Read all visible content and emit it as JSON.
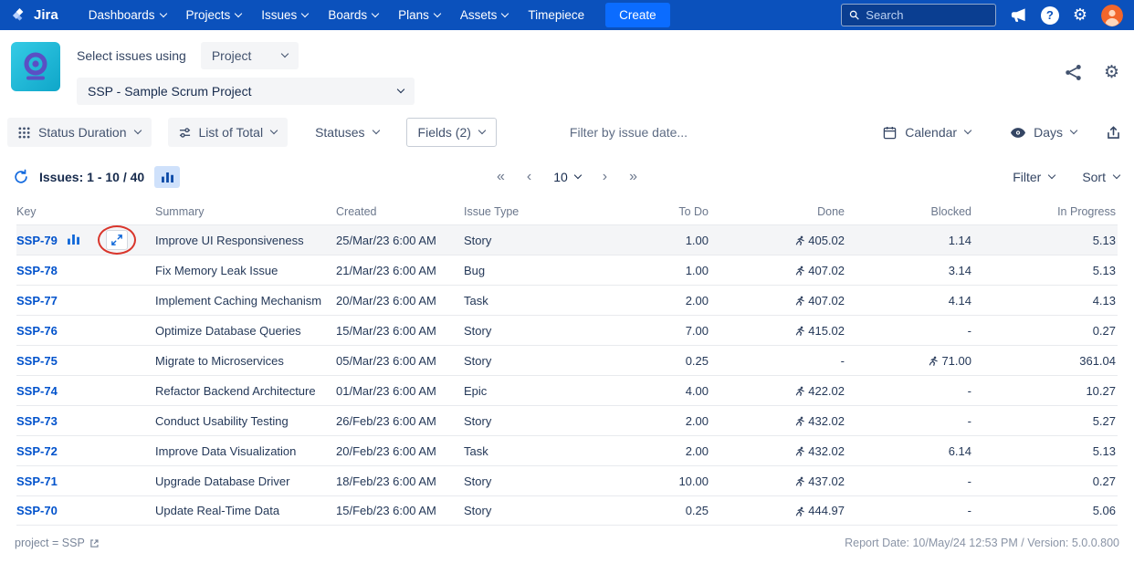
{
  "colors": {
    "nav_bg": "#0B51BC",
    "create_button": "#0B6CFF",
    "link": "#0052CC",
    "app_icon_bg": "#1BBBD4",
    "app_icon_fg": "#5B4FC4",
    "annotation_red": "#D9352B",
    "row_hover": "#F4F5F7"
  },
  "icons": {
    "help": "?",
    "gear": "⚙",
    "first_page": "«",
    "prev_page": "‹",
    "next_page": "›",
    "last_page": "»"
  },
  "topnav": {
    "brand": "Jira",
    "menus": [
      "Dashboards",
      "Projects",
      "Issues",
      "Boards",
      "Plans",
      "Assets",
      "Timepiece"
    ],
    "create_label": "Create",
    "search_placeholder": "Search"
  },
  "header": {
    "select_label": "Select issues using",
    "source_value": "Project",
    "project_value": "SSP - Sample Scrum Project"
  },
  "toolbar": {
    "status_duration_label": "Status Duration",
    "list_of_total_label": "List of Total",
    "statuses_label": "Statuses",
    "fields_label": "Fields (2)",
    "date_filter_placeholder": "Filter by issue date...",
    "calendar_label": "Calendar",
    "days_label": "Days"
  },
  "issues_bar": {
    "issues_label": "Issues: 1 - 10 / 40",
    "page_size": "10",
    "filter_label": "Filter",
    "sort_label": "Sort"
  },
  "table": {
    "columns": [
      "Key",
      "Summary",
      "Created",
      "Issue Type",
      "To Do",
      "Done",
      "Blocked",
      "In Progress"
    ],
    "rows": [
      {
        "key": "SSP-79",
        "summary": "Improve UI Responsiveness",
        "created": "25/Mar/23 6:00 AM",
        "issue_type": "Story",
        "todo": "1.00",
        "done": "405.02",
        "blocked": "1.14",
        "in_progress": "5.13",
        "done_icon": true,
        "blocked_icon": false,
        "actions": true,
        "highlighted": true
      },
      {
        "key": "SSP-78",
        "summary": "Fix Memory Leak Issue",
        "created": "21/Mar/23 6:00 AM",
        "issue_type": "Bug",
        "todo": "1.00",
        "done": "407.02",
        "blocked": "3.14",
        "in_progress": "5.13",
        "done_icon": true,
        "blocked_icon": false,
        "actions": false,
        "highlighted": false
      },
      {
        "key": "SSP-77",
        "summary": "Implement Caching Mechanism",
        "created": "20/Mar/23 6:00 AM",
        "issue_type": "Task",
        "todo": "2.00",
        "done": "407.02",
        "blocked": "4.14",
        "in_progress": "4.13",
        "done_icon": true,
        "blocked_icon": false,
        "actions": false,
        "highlighted": false
      },
      {
        "key": "SSP-76",
        "summary": "Optimize Database Queries",
        "created": "15/Mar/23 6:00 AM",
        "issue_type": "Story",
        "todo": "7.00",
        "done": "415.02",
        "blocked": "-",
        "in_progress": "0.27",
        "done_icon": true,
        "blocked_icon": false,
        "actions": false,
        "highlighted": false
      },
      {
        "key": "SSP-75",
        "summary": "Migrate to Microservices",
        "created": "05/Mar/23 6:00 AM",
        "issue_type": "Story",
        "todo": "0.25",
        "done": "-",
        "blocked": "71.00",
        "in_progress": "361.04",
        "done_icon": false,
        "blocked_icon": true,
        "actions": false,
        "highlighted": false
      },
      {
        "key": "SSP-74",
        "summary": "Refactor Backend Architecture",
        "created": "01/Mar/23 6:00 AM",
        "issue_type": "Epic",
        "todo": "4.00",
        "done": "422.02",
        "blocked": "-",
        "in_progress": "10.27",
        "done_icon": true,
        "blocked_icon": false,
        "actions": false,
        "highlighted": false
      },
      {
        "key": "SSP-73",
        "summary": "Conduct Usability Testing",
        "created": "26/Feb/23 6:00 AM",
        "issue_type": "Story",
        "todo": "2.00",
        "done": "432.02",
        "blocked": "-",
        "in_progress": "5.27",
        "done_icon": true,
        "blocked_icon": false,
        "actions": false,
        "highlighted": false
      },
      {
        "key": "SSP-72",
        "summary": "Improve Data Visualization",
        "created": "20/Feb/23 6:00 AM",
        "issue_type": "Task",
        "todo": "2.00",
        "done": "432.02",
        "blocked": "6.14",
        "in_progress": "5.13",
        "done_icon": true,
        "blocked_icon": false,
        "actions": false,
        "highlighted": false
      },
      {
        "key": "SSP-71",
        "summary": "Upgrade Database Driver",
        "created": "18/Feb/23 6:00 AM",
        "issue_type": "Story",
        "todo": "10.00",
        "done": "437.02",
        "blocked": "-",
        "in_progress": "0.27",
        "done_icon": true,
        "blocked_icon": false,
        "actions": false,
        "highlighted": false
      },
      {
        "key": "SSP-70",
        "summary": "Update Real-Time Data",
        "created": "15/Feb/23 6:00 AM",
        "issue_type": "Story",
        "todo": "0.25",
        "done": "444.97",
        "blocked": "-",
        "in_progress": "5.06",
        "done_icon": true,
        "blocked_icon": false,
        "actions": false,
        "highlighted": false
      }
    ]
  },
  "footer": {
    "filter_text": "project = SSP",
    "report_info": "Report Date: 10/May/24 12:53 PM / Version: 5.0.0.800"
  }
}
